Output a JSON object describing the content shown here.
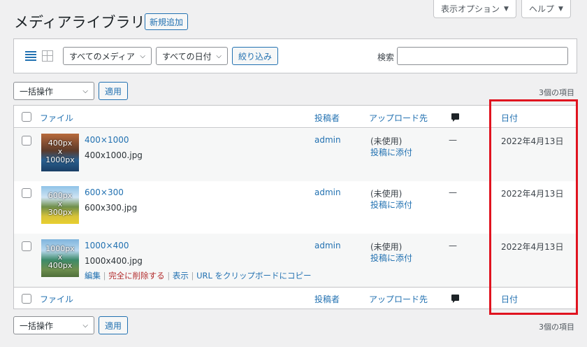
{
  "screen_options": {
    "label": "表示オプション",
    "caret": "▼"
  },
  "help": {
    "label": "ヘルプ",
    "caret": "▼"
  },
  "page": {
    "title": "メディアライブラリ",
    "add_new": "新規追加"
  },
  "filters": {
    "media_type": "すべてのメディア",
    "dates": "すべての日付",
    "filter_button": "絞り込み",
    "search_label": "検索",
    "search_value": ""
  },
  "bulk": {
    "action": "一括操作",
    "apply": "適用",
    "count": "3個の項目"
  },
  "columns": {
    "file": "ファイル",
    "author": "投稿者",
    "uploaded_to": "アップロード先",
    "date": "日付"
  },
  "rows": [
    {
      "title": "400×1000",
      "filename": "400x1000.jpg",
      "author": "admin",
      "uploaded_status": "(未使用)",
      "attach": "投稿に添付",
      "comments": "—",
      "date": "2022年4月13日",
      "thumb_l1": "400px",
      "thumb_l2": "x",
      "thumb_l3": "1000px"
    },
    {
      "title": "600×300",
      "filename": "600x300.jpg",
      "author": "admin",
      "uploaded_status": "(未使用)",
      "attach": "投稿に添付",
      "comments": "—",
      "date": "2022年4月13日",
      "thumb_l1": "600px",
      "thumb_l2": "x",
      "thumb_l3": "300px"
    },
    {
      "title": "1000×400",
      "filename": "1000x400.jpg",
      "author": "admin",
      "uploaded_status": "(未使用)",
      "attach": "投稿に添付",
      "comments": "—",
      "date": "2022年4月13日",
      "thumb_l1": "1000px",
      "thumb_l2": "x",
      "thumb_l3": "400px"
    }
  ],
  "row_actions": {
    "edit": "編集",
    "delete": "完全に削除する",
    "view": "表示",
    "copy_url": "URL をクリップボードにコピー",
    "sep": "|"
  },
  "colors": {
    "accent": "#2271b1",
    "highlight": "#e0131f",
    "danger": "#b32d2e"
  }
}
